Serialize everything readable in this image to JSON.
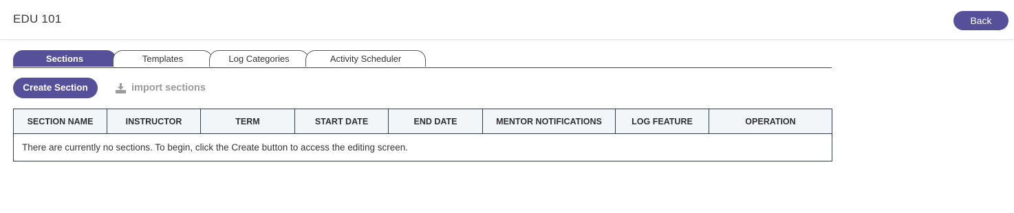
{
  "header": {
    "title": "EDU 101",
    "back_label": "Back"
  },
  "tabs": [
    {
      "label": "Sections",
      "active": true
    },
    {
      "label": "Templates",
      "active": false
    },
    {
      "label": "Log Categories",
      "active": false
    },
    {
      "label": "Activity Scheduler",
      "active": false
    }
  ],
  "toolbar": {
    "create_label": "Create Section",
    "import_label": "import sections",
    "import_icon": "download-icon"
  },
  "table": {
    "columns": [
      "SECTION NAME",
      "INSTRUCTOR",
      "TERM",
      "START DATE",
      "END DATE",
      "MENTOR NOTIFICATIONS",
      "LOG FEATURE",
      "OPERATION"
    ],
    "empty_message": "There are currently no sections. To begin, click the Create button to access the editing screen."
  },
  "colors": {
    "accent": "#56509a",
    "header_bg": "#f3f6f9",
    "muted": "#9b9b9b"
  }
}
